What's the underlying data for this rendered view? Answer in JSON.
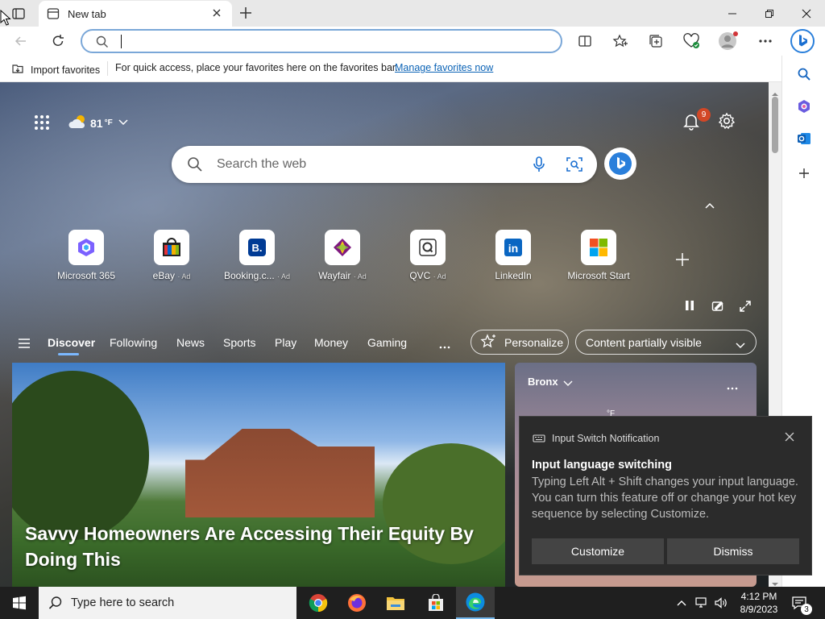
{
  "tab": {
    "title": "New tab"
  },
  "favorites_bar": {
    "import_label": "Import favorites",
    "message": "For quick access, place your favorites here on the favorites bar.",
    "manage_link": "Manage favorites now"
  },
  "newtab": {
    "weather_temp": "81",
    "weather_unit": "°F",
    "notification_count": "9",
    "search_placeholder": "Search the web",
    "quick_links": [
      {
        "label": "Microsoft 365",
        "ad": ""
      },
      {
        "label": "eBay",
        "ad": "· Ad"
      },
      {
        "label": "Booking.c...",
        "ad": "· Ad"
      },
      {
        "label": "Wayfair",
        "ad": "· Ad"
      },
      {
        "label": "QVC",
        "ad": "· Ad"
      },
      {
        "label": "LinkedIn",
        "ad": ""
      },
      {
        "label": "Microsoft Start",
        "ad": ""
      }
    ],
    "nav": [
      "Discover",
      "Following",
      "News",
      "Sports",
      "Play",
      "Money",
      "Gaming"
    ],
    "personalize_label": "Personalize",
    "visibility_label": "Content partially visible",
    "headline": "Savvy Homeowners Are Accessing Their Equity By Doing This",
    "weather_card": {
      "location": "Bronx",
      "temp_fragment": "°F"
    }
  },
  "notification": {
    "app_title": "Input Switch Notification",
    "heading": "Input language switching",
    "body": "Typing Left Alt + Shift changes your input language. You can turn this feature off or change your hot key sequence by selecting Customize.",
    "customize_label": "Customize",
    "dismiss_label": "Dismiss"
  },
  "taskbar": {
    "search_placeholder": "Type here to search",
    "time": "4:12 PM",
    "date": "8/9/2023",
    "notification_count": "3"
  },
  "colors": {
    "accent_link": "#0b63b6",
    "address_border": "#7aa7d8",
    "notification_badge": "#d24726",
    "taskbar_bg": "#1f1f1f",
    "toast_bg": "#2b2b2b"
  }
}
